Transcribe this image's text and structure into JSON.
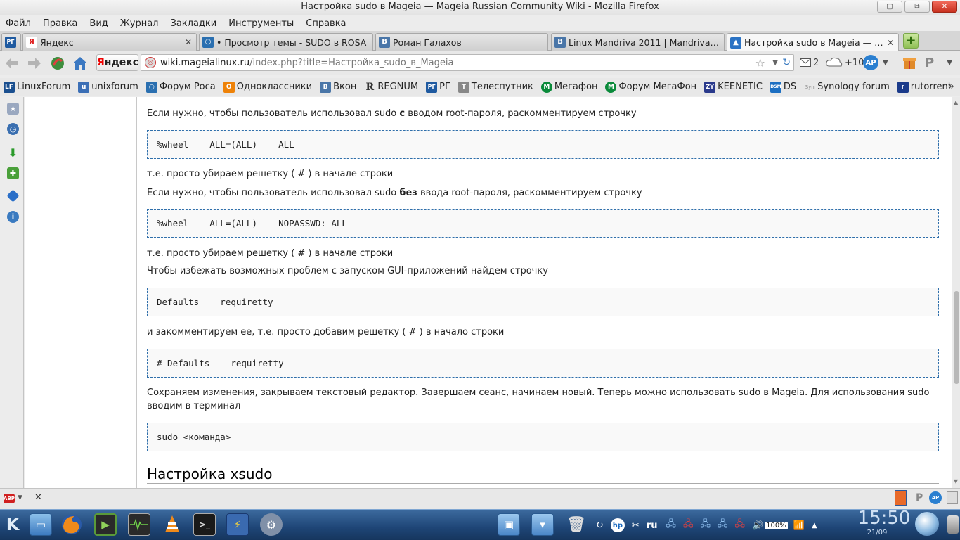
{
  "window": {
    "title": "Настройка sudo в Mageia — Mageia Russian Community Wiki - Mozilla Firefox",
    "btn_min": "▢",
    "btn_restore": "⧉",
    "btn_close": "✕"
  },
  "menu": [
    "Файл",
    "Правка",
    "Вид",
    "Журнал",
    "Закладки",
    "Инструменты",
    "Справка"
  ],
  "tabs": [
    {
      "label": "Яндекс",
      "fav": "Я",
      "color": "#e02020",
      "active": false
    },
    {
      "label": "• Просмотр темы - SUDO в ROSA",
      "fav": "○",
      "color": "#2a6fb0",
      "active": false
    },
    {
      "label": "Роман Галахов",
      "fav": "B",
      "color": "#4a76a8",
      "active": false
    },
    {
      "label": "Linux Mandriva 2011 | Mandriva ...",
      "fav": "B",
      "color": "#4a76a8",
      "active": false
    },
    {
      "label": "Настройка sudo в Mageia — Ma...",
      "fav": "▲",
      "color": "#2a72c4",
      "active": true
    }
  ],
  "first_tab_fav": "РГ",
  "tab_close": "✕",
  "new_tab": "+",
  "nav": {
    "yandex_ya": "Я",
    "yandex_rest": "ндекс",
    "url_host": "wiki.mageialinux.ru",
    "url_rest": "/index.php?title=Настройка_sudo_в_Mageia",
    "mail_count": "2",
    "weather": "+10",
    "ap": "AP",
    "p": "P"
  },
  "bookmarks": [
    {
      "label": "LinuxForum",
      "icon": "LF",
      "color": "#1a4f8f"
    },
    {
      "label": "unixforum",
      "icon": "u",
      "color": "#3b6fb6"
    },
    {
      "label": "Форум Роса",
      "icon": "○",
      "color": "#2a6fb0"
    },
    {
      "label": "Одноклассники",
      "icon": "О",
      "color": "#ee8208"
    },
    {
      "label": "Вкон",
      "icon": "В",
      "color": "#4a76a8"
    },
    {
      "label": "REGNUM",
      "icon": "R",
      "color": "#333333"
    },
    {
      "label": "РГ",
      "icon": "РГ",
      "color": "#1f5aa0"
    },
    {
      "label": "Телеспутник",
      "icon": "Т",
      "color": "#888888"
    },
    {
      "label": "Мегафон",
      "icon": "М",
      "color": "#0a8a3a"
    },
    {
      "label": "Форум МегаФон",
      "icon": "М",
      "color": "#0a8a3a"
    },
    {
      "label": "KEENETIC",
      "icon": "ZY",
      "color": "#2a3a8c"
    },
    {
      "label": "DS",
      "icon": "DSM",
      "color": "#1c6fc2"
    },
    {
      "label": "Synology forum",
      "icon": "Syn",
      "color": "#999999"
    },
    {
      "label": "rutorrent",
      "icon": "r",
      "color": "#1a3a8a"
    }
  ],
  "content": {
    "line1_pre": "Если нужно, чтобы пользователь использовал sudo ",
    "line1_bold": "с",
    "line1_post": " вводом root-пароля, раскомментируем строчку",
    "code1": "%wheel    ALL=(ALL)    ALL",
    "line2": "т.е. просто убираем решетку ( # ) в начале строки",
    "line3_pre": "Если нужно, чтобы пользователь использовал sudo ",
    "line3_bold": "без",
    "line3_post": " ввода root-пароля, раскомментируем строчку",
    "code2": "%wheel    ALL=(ALL)    NOPASSWD: ALL",
    "line4": "т.е. просто убираем решетку ( # ) в начале строки",
    "line5": "Чтобы избежать возможных проблем с запуском GUI-приложений найдем строчку",
    "code3": "Defaults    requiretty",
    "line6": "и закомментируем ее, т.е. просто добавим решетку ( # ) в начало строки",
    "code4": "# Defaults    requiretty",
    "para": "Сохраняем изменения, закрываем текстовый редактор. Завершаем сеанс, начинаем новый. Теперь можно использовать sudo в Mageia. Для использования sudo вводим в терминал",
    "code5": "sudo <команда>",
    "heading": "Настройка xsudo"
  },
  "statusbar": {
    "abp": "ABP",
    "close": "✕"
  },
  "taskbar": {
    "time": "15:50",
    "date": "21/09",
    "lang": "ru",
    "volume": "100%"
  }
}
